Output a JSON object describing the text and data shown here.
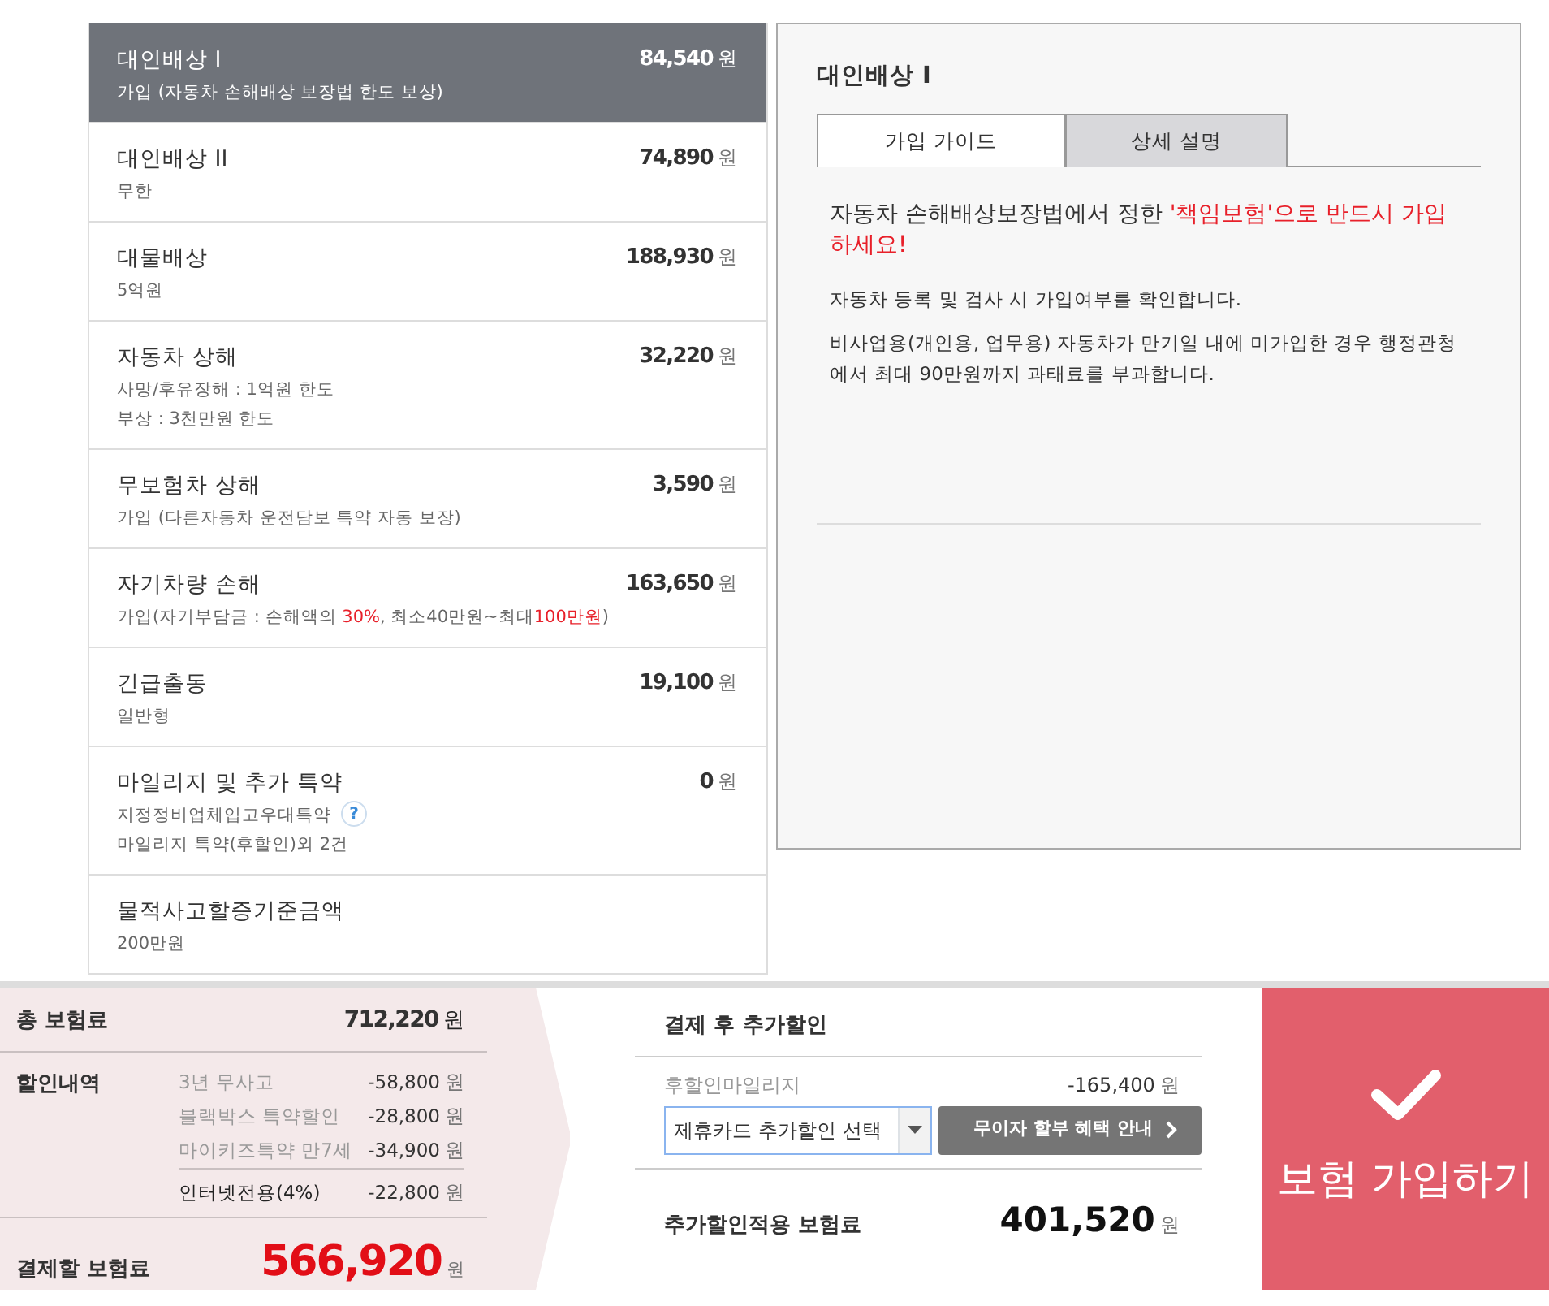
{
  "coverages": [
    {
      "title": "대인배상 I",
      "amount": "84,540",
      "unit": "원",
      "selected": true,
      "lines": [
        [
          {
            "text": "가입 (자동차 손해배상 보장법 한도 보상)",
            "highlight": false
          }
        ]
      ]
    },
    {
      "title": "대인배상 II",
      "amount": "74,890",
      "unit": "원",
      "selected": false,
      "lines": [
        [
          {
            "text": "무한",
            "highlight": false
          }
        ]
      ]
    },
    {
      "title": "대물배상",
      "amount": "188,930",
      "unit": "원",
      "selected": false,
      "lines": [
        [
          {
            "text": "5억원",
            "highlight": false
          }
        ]
      ]
    },
    {
      "title": "자동차 상해",
      "amount": "32,220",
      "unit": "원",
      "selected": false,
      "lines": [
        [
          {
            "text": "사망/후유장해 : 1억원 한도",
            "highlight": false
          }
        ],
        [
          {
            "text": "부상 : 3천만원 한도",
            "highlight": false
          }
        ]
      ]
    },
    {
      "title": "무보험차 상해",
      "amount": "3,590",
      "unit": "원",
      "selected": false,
      "lines": [
        [
          {
            "text": "가입 (다른자동차 운전담보 특약 자동 보장)",
            "highlight": false
          }
        ]
      ]
    },
    {
      "title": "자기차량 손해",
      "amount": "163,650",
      "unit": "원",
      "selected": false,
      "lines": [
        [
          {
            "text": "가입(자기부담금 : 손해액의 ",
            "highlight": false
          },
          {
            "text": "30%",
            "highlight": true
          },
          {
            "text": ", 최소40만원~최대",
            "highlight": false
          },
          {
            "text": "100만원",
            "highlight": true
          },
          {
            "text": ")",
            "highlight": false
          }
        ]
      ]
    },
    {
      "title": "긴급출동",
      "amount": "19,100",
      "unit": "원",
      "selected": false,
      "lines": [
        [
          {
            "text": "일반형",
            "highlight": false
          }
        ]
      ]
    },
    {
      "title": "마일리지 및 추가 특약",
      "amount": "0",
      "unit": "원",
      "selected": false,
      "help": "?",
      "lines": [
        [
          {
            "text": "지정정비업체입고우대특약",
            "highlight": false
          }
        ],
        [
          {
            "text": "마일리지 특약(후할인)외 2건",
            "highlight": false
          }
        ]
      ]
    },
    {
      "title": "물적사고할증기준금액",
      "selected": false,
      "lines": [
        [
          {
            "text": "200만원",
            "highlight": false
          }
        ]
      ]
    }
  ],
  "detail": {
    "title": "대인배상 I",
    "tabs": [
      {
        "label": "가입 가이드",
        "selected": true
      },
      {
        "label": "상세 설명",
        "selected": false
      }
    ],
    "lead": [
      {
        "text": "자동차 손해배상보장법에서 정한 ",
        "highlight": false
      },
      {
        "text": "'책임보험'으로 반드시 가입하세요!",
        "highlight": true
      }
    ],
    "paragraphs": [
      "자동차 등록 및 검사 시 가입여부를 확인합니다.",
      "비사업용(개인용, 업무용) 자동차가 만기일 내에 미가입한 경우 행정관청에서 최대 90만원까지 과태료를 부과합니다."
    ]
  },
  "summary": {
    "total": {
      "label": "총 보험료",
      "amount": "712,220",
      "unit": "원"
    },
    "discounts": {
      "label": "할인내역",
      "items": [
        {
          "label": "3년 무사고",
          "amount": "-58,800",
          "unit": "원",
          "kind": "minor"
        },
        {
          "label": "블랙박스 특약할인",
          "amount": "-28,800",
          "unit": "원",
          "kind": "minor"
        },
        {
          "label": "마이키즈특약 만7세",
          "amount": "-34,900",
          "unit": "원",
          "kind": "minor"
        },
        {
          "label": "인터넷전용(4%)",
          "amount": "-22,800",
          "unit": "원",
          "kind": "major"
        }
      ]
    },
    "payable": {
      "label": "결제할 보험료",
      "amount": "566,920",
      "unit": "원"
    }
  },
  "extra": {
    "title": "결제 후 추가할인",
    "mileage": {
      "label": "후할인마일리지",
      "amount": "-165,400",
      "unit": "원"
    },
    "card_select": {
      "value": "제휴카드 추가할인 선택"
    },
    "installment_button": "무이자 할부 혜택 안내",
    "applied": {
      "label": "추가할인적용 보험료",
      "amount": "401,520",
      "unit": "원"
    }
  },
  "cta": {
    "label": "보험 가입하기"
  }
}
